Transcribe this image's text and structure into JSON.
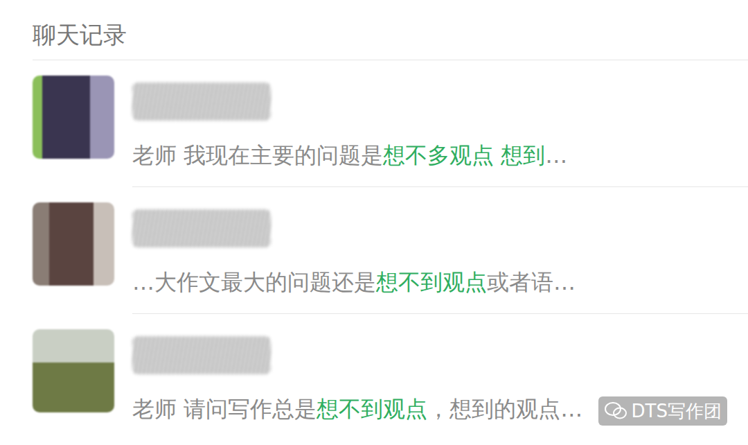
{
  "header": {
    "title": "聊天记录"
  },
  "results": [
    {
      "segments": [
        {
          "text": "老师  我现在主要的问题是",
          "highlight": false
        },
        {
          "text": "想不多观点  想到",
          "highlight": true
        },
        {
          "text": "…",
          "highlight": false
        }
      ]
    },
    {
      "segments": [
        {
          "text": "…大作文最大的问题还是",
          "highlight": false
        },
        {
          "text": "想不到观点",
          "highlight": true
        },
        {
          "text": "或者语…",
          "highlight": false
        }
      ]
    },
    {
      "segments": [
        {
          "text": "老师 请问写作总是",
          "highlight": false
        },
        {
          "text": "想不到观点",
          "highlight": true
        },
        {
          "text": "，想到的观点…",
          "highlight": false
        }
      ]
    }
  ],
  "watermark": {
    "text": "DTS写作团"
  }
}
